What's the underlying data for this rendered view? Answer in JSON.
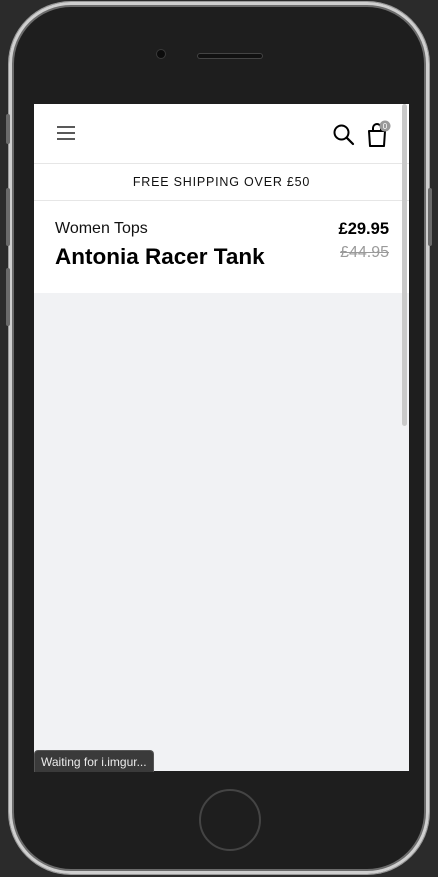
{
  "header": {
    "menu_icon": "hamburger-menu-icon",
    "search_icon": "search-icon",
    "cart_icon": "shopping-bag-icon",
    "cart_count": "0"
  },
  "banner": {
    "text": "FREE SHIPPING OVER £50"
  },
  "product": {
    "category": "Women Tops",
    "name": "Antonia Racer Tank",
    "price": "£29.95",
    "original_price": "£44.95"
  },
  "browser_status": {
    "text": "Waiting for i.imgur..."
  }
}
